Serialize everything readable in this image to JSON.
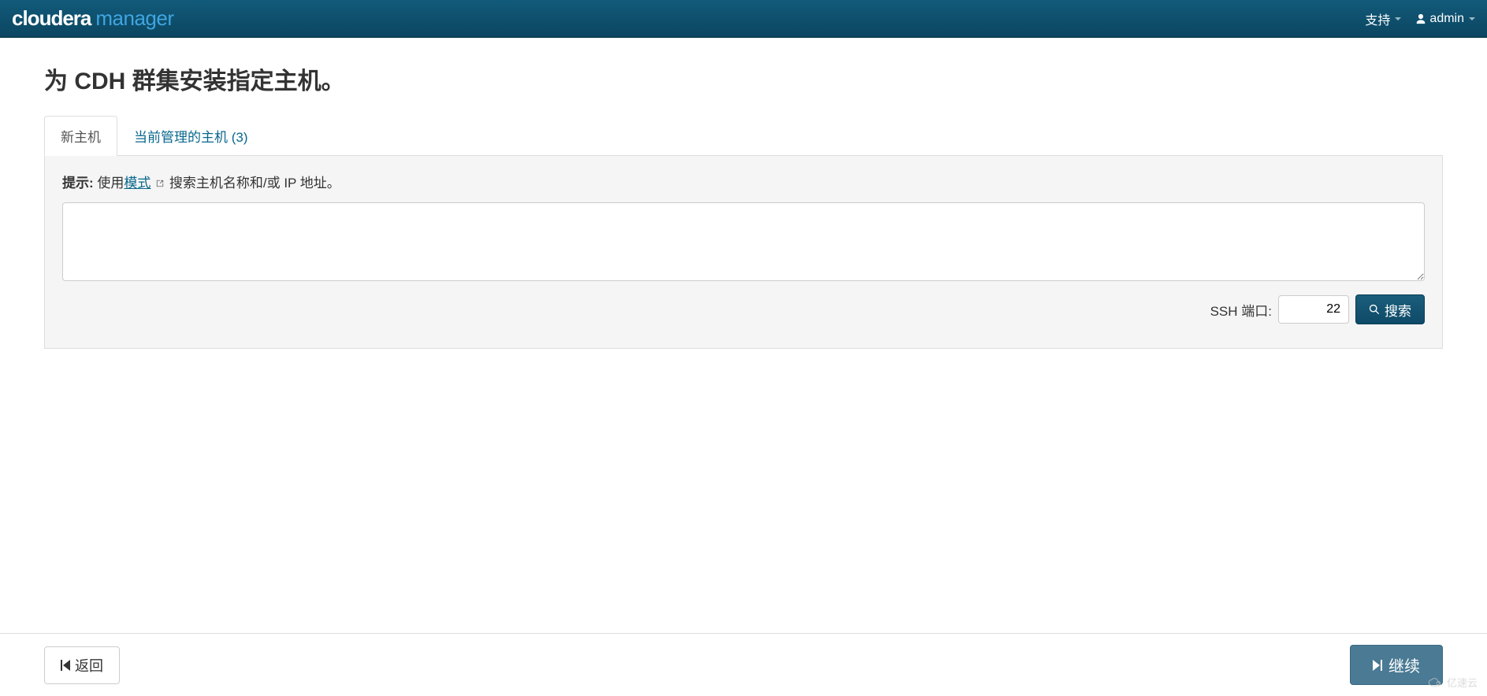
{
  "navbar": {
    "logo_primary": "cloudera",
    "logo_secondary": "manager",
    "support_label": "支持",
    "user_label": "admin"
  },
  "page": {
    "title": "为 CDH 群集安装指定主机。"
  },
  "tabs": {
    "new_hosts": "新主机",
    "managed_hosts": "当前管理的主机 (3)"
  },
  "content": {
    "hint_label": "提示:",
    "hint_prefix": " 使用",
    "hint_link": "模式",
    "hint_suffix": "搜索主机名称和/或 IP 地址。",
    "ssh_port_label": "SSH 端口:",
    "ssh_port_value": "22",
    "search_button": "搜索"
  },
  "footer": {
    "back_label": "返回",
    "continue_label": "继续"
  },
  "watermark": {
    "text": "亿速云"
  }
}
